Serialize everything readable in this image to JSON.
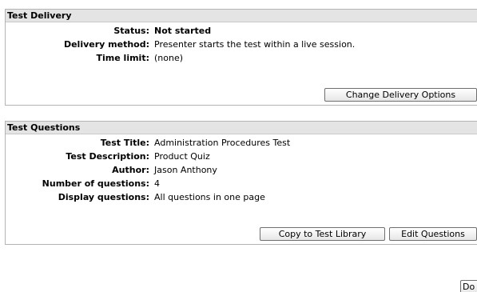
{
  "delivery": {
    "title": "Test Delivery",
    "rows": [
      {
        "label": "Status:",
        "value": "Not started"
      },
      {
        "label": "Delivery method:",
        "value": "Presenter starts the test within a live session."
      },
      {
        "label": "Time limit:",
        "value": "(none)"
      }
    ],
    "change_button": "Change Delivery Options"
  },
  "questions": {
    "title": "Test Questions",
    "rows": [
      {
        "label": "Test Title:",
        "value": "Administration Procedures Test"
      },
      {
        "label": "Test Description:",
        "value": "Product Quiz"
      },
      {
        "label": "Author:",
        "value": "Jason Anthony"
      },
      {
        "label": "Number of questions:",
        "value": "4"
      },
      {
        "label": "Display questions:",
        "value": "All questions in one page"
      }
    ],
    "copy_button": "Copy to Test Library",
    "edit_button": "Edit Questions"
  },
  "footer": {
    "done_button": "Do"
  }
}
